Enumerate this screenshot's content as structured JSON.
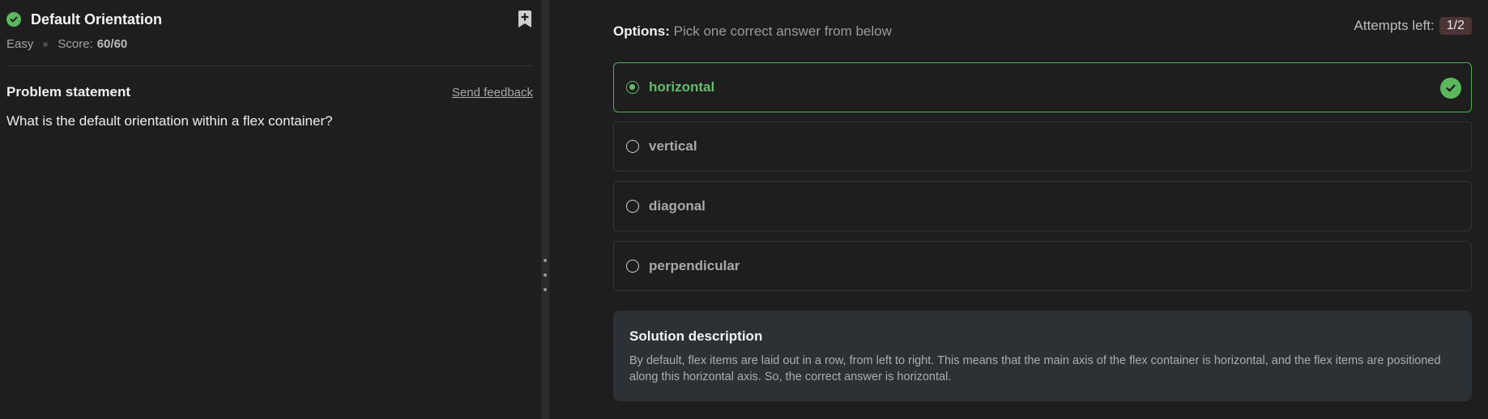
{
  "question": {
    "title": "Default Orientation",
    "difficulty": "Easy",
    "score_label": "Score:",
    "score_value": "60/60",
    "problem_statement_label": "Problem statement",
    "send_feedback": "Send feedback",
    "text": "What is the default orientation within a flex container?"
  },
  "options": {
    "header_bold": "Options:",
    "header_rest": "Pick one correct answer from below",
    "attempts_label": "Attempts left:",
    "attempts_value": "1/2",
    "items": [
      {
        "label": "horizontal",
        "selected": true,
        "correct": true
      },
      {
        "label": "vertical",
        "selected": false,
        "correct": false
      },
      {
        "label": "diagonal",
        "selected": false,
        "correct": false
      },
      {
        "label": "perpendicular",
        "selected": false,
        "correct": false
      }
    ]
  },
  "solution": {
    "title": "Solution description",
    "text": "By default, flex items are laid out in a row, from left to right. This means that the main axis of the flex container is horizontal, and the flex items are positioned along this horizontal axis. So, the correct answer is horizontal."
  },
  "colors": {
    "accent_green": "#5cb85c",
    "background": "#1e1e1e",
    "solution_bg": "#2b3134"
  },
  "icons": [
    "check-circle-icon",
    "bookmark-add-icon",
    "drag-handle-icon",
    "radio-icon"
  ]
}
